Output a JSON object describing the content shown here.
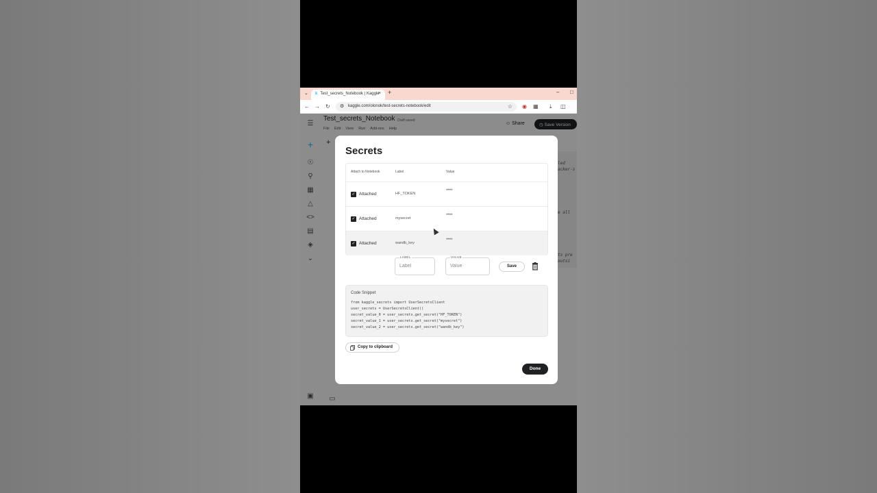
{
  "browser": {
    "tab_title": "Test_secrets_Notebook | Kaggle",
    "url": "kaggle.com/olonok/test-secrets-notebook/edit"
  },
  "notebook": {
    "title": "Test_secrets_Notebook",
    "status": "Draft saved",
    "menu": [
      "File",
      "Edit",
      "View",
      "Run",
      "Add-ons",
      "Help"
    ],
    "share_label": "Share",
    "save_version_label": "Save Version",
    "add_cell": "+",
    "code_fragments": [
      "led",
      "acker-s",
      "e all",
      "ts pre",
      "outsi"
    ]
  },
  "dialog": {
    "title": "Secrets",
    "columns": {
      "attach": "Attach to Notebook",
      "label": "Label",
      "value": "Value"
    },
    "rows": [
      {
        "status": "Attached",
        "label": "HF_TOKEN",
        "value": "*****"
      },
      {
        "status": "Attached",
        "label": "mysecret",
        "value": "*****"
      },
      {
        "status": "Attached",
        "label": "wandb_key",
        "value": "*****"
      }
    ],
    "new_label": {
      "caption": "LABEL",
      "placeholder": "Label"
    },
    "new_value": {
      "caption": "VALUE",
      "placeholder": "Value"
    },
    "save_label": "Save",
    "snippet_heading": "Code Snippet",
    "snippet_lines": [
      "from kaggle_secrets import UserSecretsClient",
      "user_secrets = UserSecretsClient()",
      "secret_value_0 = user_secrets.get_secret(\"HF_TOKEN\")",
      "secret_value_1 = user_secrets.get_secret(\"mysecret\")",
      "secret_value_2 = user_secrets.get_secret(\"wandb_key\")"
    ],
    "copy_label": "Copy to clipboard",
    "done_label": "Done"
  },
  "colors": {
    "accent": "#20beff",
    "dark": "#202124",
    "tabbar": "#f9d9cf"
  },
  "icons": [
    "menu-icon",
    "plus-icon",
    "compass-icon",
    "trophy-icon",
    "table-icon",
    "models-icon",
    "code-icon",
    "comments-icon",
    "learn-icon",
    "chevron-down-icon",
    "trash-icon",
    "copy-icon"
  ]
}
